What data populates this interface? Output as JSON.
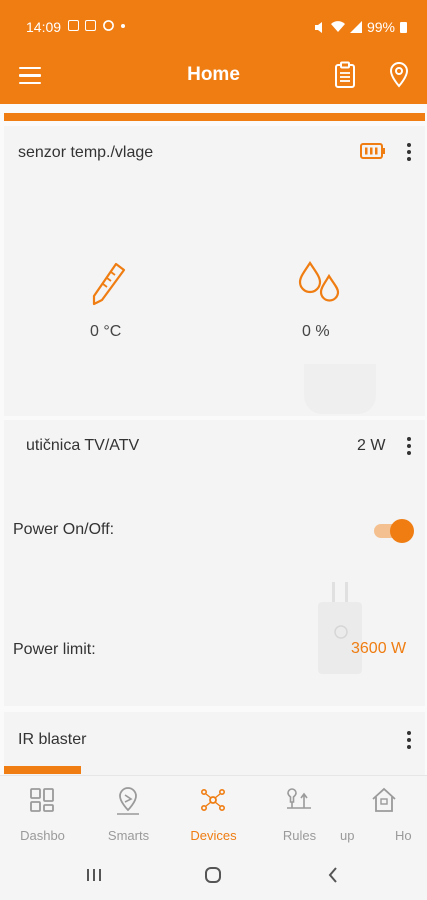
{
  "status_bar": {
    "time": "14:09",
    "battery": "99%"
  },
  "app_bar": {
    "title": "Home"
  },
  "cards": {
    "sensor": {
      "title": "senzor temp./vlage",
      "temperature": "0 °C",
      "humidity": "0 %"
    },
    "socket": {
      "title": "utičnica TV/ATV",
      "power": "2 W",
      "power_onoff_label": "Power On/Off:",
      "power_limit_label": "Power limit:",
      "power_limit_value": "3600 W",
      "power_on": true
    },
    "ir": {
      "title": "IR blaster"
    }
  },
  "bottom_nav": {
    "items": [
      {
        "label": "Dashbo",
        "icon": "dashboard-icon"
      },
      {
        "label": "Smarts",
        "icon": "smarts-icon"
      },
      {
        "label": "Devices",
        "icon": "devices-icon",
        "active": true
      },
      {
        "label": "Rules",
        "icon": "rules-icon"
      },
      {
        "label": "up",
        "icon": "setup-icon"
      },
      {
        "label": "Ho",
        "icon": "home-icon"
      }
    ]
  },
  "colors": {
    "accent": "#ef7d12",
    "background": "#fafafa",
    "card": "#f4f4f4"
  }
}
